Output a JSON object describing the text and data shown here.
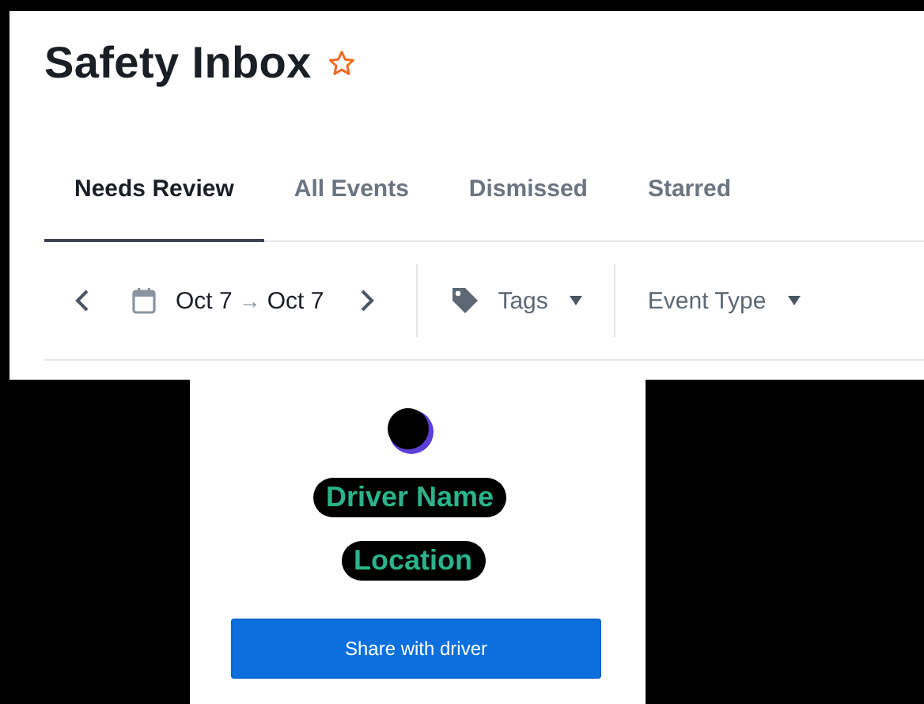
{
  "header": {
    "title": "Safety Inbox",
    "starred": false
  },
  "tabs": [
    {
      "label": "Needs Review",
      "selected": true
    },
    {
      "label": "All Events",
      "selected": false
    },
    {
      "label": "Dismissed",
      "selected": false
    },
    {
      "label": "Starred",
      "selected": false
    }
  ],
  "filters": {
    "date_start": "Oct 7",
    "arrow": "→",
    "date_end": "Oct 7",
    "tags": "Tags",
    "event_type": "Event Type"
  },
  "card": {
    "driver_name": "Driver Name",
    "location": "Location",
    "button": "Share with driver"
  }
}
